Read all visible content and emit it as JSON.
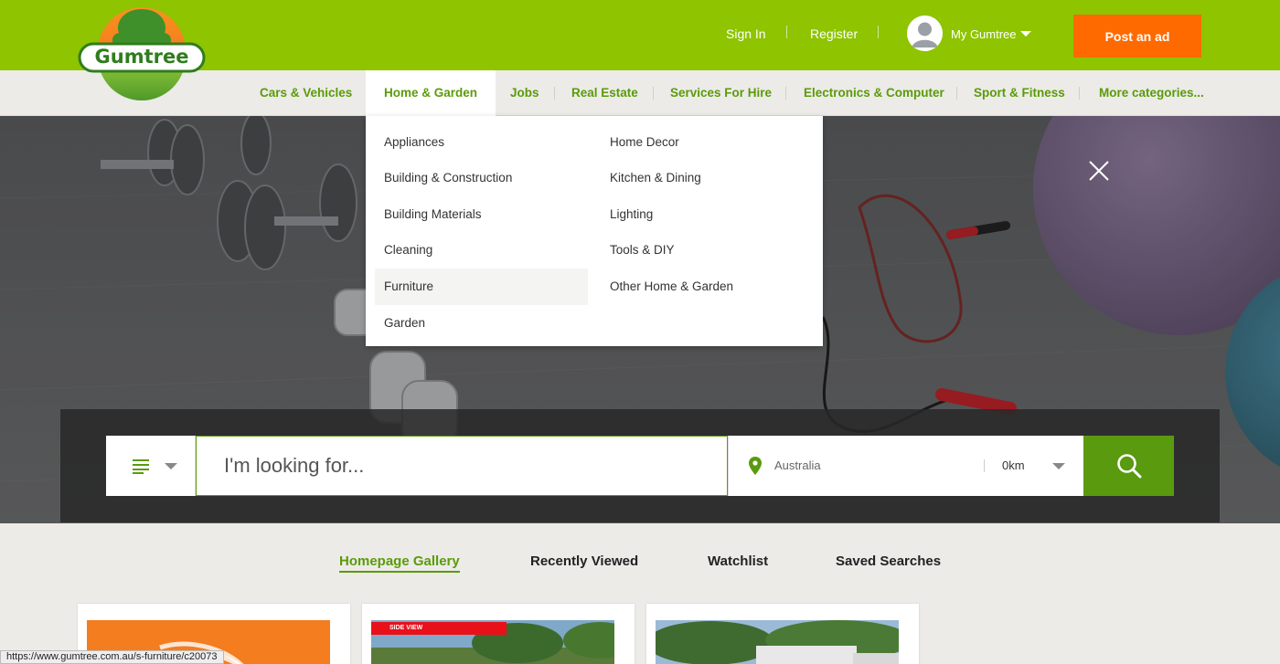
{
  "header": {
    "logo_text": "Gumtree",
    "sign_in": "Sign In",
    "register": "Register",
    "my_gumtree": "My Gumtree",
    "post_ad": "Post an ad",
    "colors": {
      "brand_green": "#8ec400",
      "accent_orange": "#fe6a00",
      "link_green": "#5b9b08"
    }
  },
  "nav": {
    "categories": [
      {
        "label": "Cars & Vehicles"
      },
      {
        "label": "Home & Garden"
      },
      {
        "label": "Jobs"
      },
      {
        "label": "Real Estate"
      },
      {
        "label": "Services For Hire"
      },
      {
        "label": "Electronics & Computer"
      },
      {
        "label": "Sport & Fitness"
      },
      {
        "label": "More categories..."
      }
    ],
    "active": "Home & Garden"
  },
  "dropdown": {
    "col1": [
      "Appliances",
      "Building & Construction",
      "Building Materials",
      "Cleaning",
      "Furniture",
      "Garden"
    ],
    "col2": [
      "Home Decor",
      "Kitchen & Dining",
      "Lighting",
      "Tools & DIY",
      "Other Home & Garden"
    ],
    "highlighted": "Furniture"
  },
  "hero": {
    "close_icon": "close-icon"
  },
  "search": {
    "category_icon": "list-icon",
    "placeholder": "I'm looking for...",
    "location_icon": "map-pin-icon",
    "location": "Australia",
    "radius": "0km",
    "search_icon": "magnifier-icon"
  },
  "tabs": [
    "Homepage Gallery",
    "Recently Viewed",
    "Watchlist",
    "Saved Searches"
  ],
  "active_tab": "Homepage Gallery",
  "cards": [
    {
      "badge": ""
    },
    {
      "badge": "SIDE VIEW"
    },
    {
      "badge": ""
    }
  ],
  "status_url": "https://www.gumtree.com.au/s-furniture/c20073"
}
